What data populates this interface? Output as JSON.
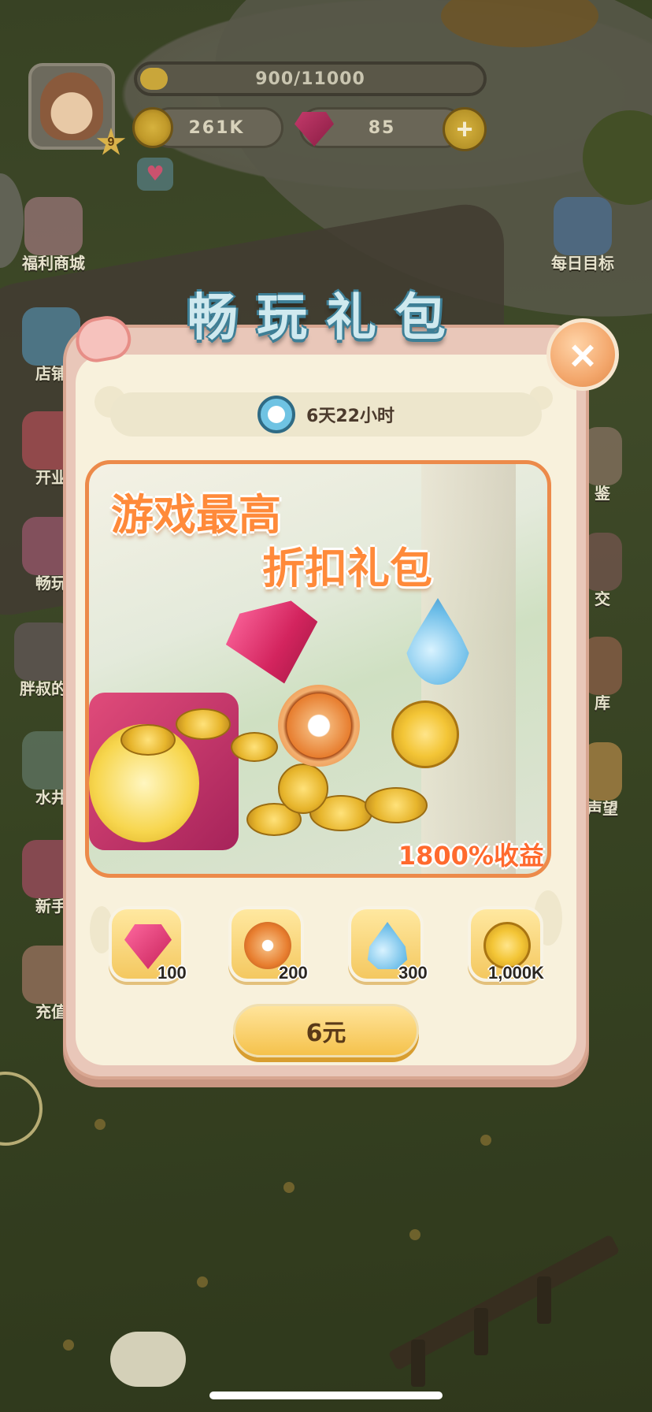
{
  "hud": {
    "level": "9",
    "xp_text": "900/11000",
    "xp_progress": 0.082,
    "coins": "261K",
    "gems": "85"
  },
  "side_left": [
    "福利商城",
    "店铺",
    "开业",
    "畅玩",
    "胖叔的",
    "水井",
    "新手",
    "充值"
  ],
  "side_right": [
    "每日目标",
    "鉴",
    "交",
    "库",
    "声望"
  ],
  "modal": {
    "title": "畅玩礼包",
    "timer": "6天22小时",
    "banner_line1": "游戏最高",
    "banner_line2": "折扣礼包",
    "profit": "1800%收益",
    "rewards": [
      {
        "icon": "gem-icon",
        "qty": "100"
      },
      {
        "icon": "flower-icon",
        "qty": "200"
      },
      {
        "icon": "water-drop-icon",
        "qty": "300"
      },
      {
        "icon": "coin-icon",
        "qty": "1,000K"
      }
    ],
    "price_label": "6元",
    "close_label": "×"
  },
  "colors": {
    "title_fill": "#cfe9ef",
    "title_outline": "#3e7f96",
    "banner_text": "#ff8a3a",
    "buy_button": "#f5c24c",
    "modal_bg": "#f8f1dc"
  }
}
